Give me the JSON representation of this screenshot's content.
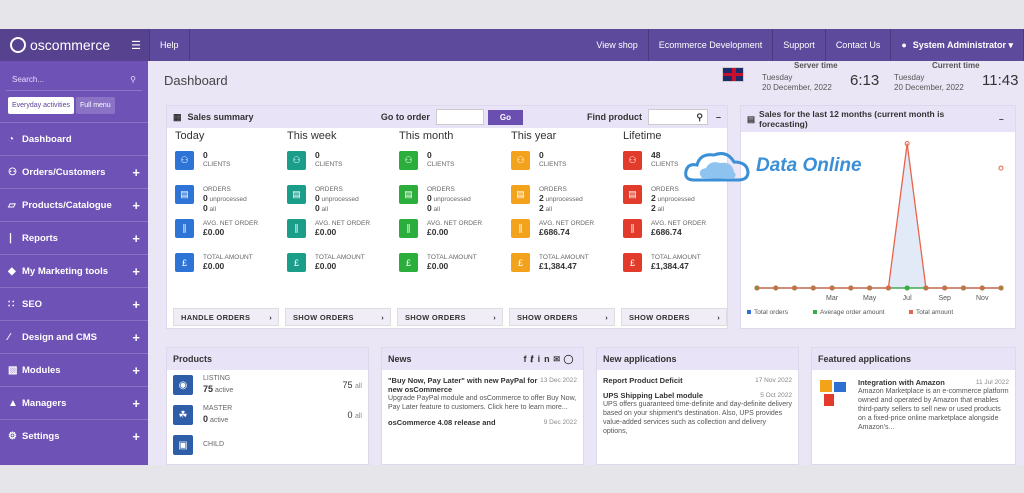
{
  "topbar": {
    "logo": "oscommerce",
    "help": "Help",
    "view_shop": "View shop",
    "ecom_dev": "Ecommerce Development",
    "support": "Support",
    "contact": "Contact Us",
    "user": "System Administrator ▾"
  },
  "sidebar": {
    "search_placeholder": "Search...",
    "tab_everyday": "Everyday activities",
    "tab_full": "Full menu",
    "items": [
      {
        "label": "Dashboard",
        "icon": "tachometer-icon"
      },
      {
        "label": "Orders/Customers",
        "icon": "users-icon"
      },
      {
        "label": "Products/Catalogue",
        "icon": "folder-icon"
      },
      {
        "label": "Reports",
        "icon": "chart-icon"
      },
      {
        "label": "My Marketing tools",
        "icon": "tag-icon"
      },
      {
        "label": "SEO",
        "icon": "sitemap-icon"
      },
      {
        "label": "Design and CMS",
        "icon": "brush-icon"
      },
      {
        "label": "Modules",
        "icon": "puzzle-icon"
      },
      {
        "label": "Managers",
        "icon": "user-icon"
      },
      {
        "label": "Settings",
        "icon": "cogs-icon"
      }
    ]
  },
  "header": {
    "title": "Dashboard",
    "server_label": "Server time",
    "server_day": "Tuesday",
    "server_date": "20 December, 2022",
    "server_time": "6:13",
    "current_label": "Current time",
    "current_day": "Tuesday",
    "current_date": "20 December, 2022",
    "current_time": "11:43"
  },
  "sales": {
    "title": "Sales summary",
    "go_to_order": "Go to order",
    "go": "Go",
    "find_product": "Find product",
    "columns": [
      {
        "title": "Today",
        "color": "#2e73d6",
        "clients": "0",
        "orders": "0",
        "unprocessed": "0",
        "all": "0",
        "avg": "£0.00",
        "total": "£0.00",
        "btn": "HANDLE ORDERS"
      },
      {
        "title": "This week",
        "color": "#1a9e8a",
        "clients": "0",
        "orders": "0",
        "unprocessed": "0",
        "all": "0",
        "avg": "£0.00",
        "total": "£0.00",
        "btn": "SHOW ORDERS"
      },
      {
        "title": "This month",
        "color": "#2cae3c",
        "clients": "0",
        "orders": "0",
        "unprocessed": "0",
        "all": "0",
        "avg": "£0.00",
        "total": "£0.00",
        "btn": "SHOW ORDERS"
      },
      {
        "title": "This year",
        "color": "#f3a21c",
        "clients": "0",
        "orders": "0",
        "unprocessed": "2",
        "all": "2",
        "avg": "£686.74",
        "total": "£1,384.47",
        "btn": "SHOW ORDERS"
      },
      {
        "title": "Lifetime",
        "color": "#e23b2c",
        "clients": "48",
        "orders": "0",
        "unprocessed": "2",
        "all": "2",
        "avg": "£686.74",
        "total": "£1,384.47",
        "btn": "SHOW ORDERS"
      }
    ],
    "lbl_clients": "CLIENTS",
    "lbl_orders": "ORDERS",
    "lbl_unprocessed": "unprocessed",
    "lbl_all": "all",
    "lbl_avg": "AVG. NET ORDER",
    "lbl_total": "TOTAL AMOUNT"
  },
  "chart_title": "Sales for the last 12 months (current month is forecasting)",
  "chart_data": {
    "type": "line",
    "x": [
      "",
      "",
      "",
      "",
      "Mar",
      "",
      "May",
      "",
      "Jul",
      "",
      "Sep",
      "",
      "Nov",
      ""
    ],
    "ticks": [
      "Mar",
      "May",
      "Jul",
      "Sep",
      "Nov"
    ],
    "series": [
      {
        "name": "Total orders",
        "color": "#2e6fd1",
        "values": [
          0,
          0,
          0,
          0,
          0,
          0,
          0,
          0,
          0,
          0,
          0,
          0,
          0,
          0
        ]
      },
      {
        "name": "Average order amount",
        "color": "#3cae3c",
        "values": [
          0,
          0,
          0,
          0,
          0,
          0,
          0,
          0,
          0,
          0,
          0,
          0,
          0,
          0
        ]
      },
      {
        "name": "Total amount",
        "color": "#e8654a",
        "values": [
          0,
          0,
          0,
          0,
          0,
          0,
          0,
          0,
          1384.47,
          0,
          0,
          0,
          0,
          0
        ]
      }
    ],
    "forecast_point": {
      "index": 13,
      "value": 1150
    },
    "ylim": [
      0,
      1400
    ]
  },
  "products": {
    "title": "Products",
    "items": [
      {
        "label": "LISTING",
        "count": "75",
        "state": "active",
        "total": "75",
        "total_lbl": "all"
      },
      {
        "label": "MASTER",
        "count": "0",
        "state": "active",
        "total": "0",
        "total_lbl": "all"
      },
      {
        "label": "CHILD",
        "count": "",
        "state": "",
        "total": "",
        "total_lbl": ""
      }
    ]
  },
  "news": {
    "title": "News",
    "items": [
      {
        "title": "\"Buy Now, Pay Later\" with new PayPal for new osCommerce",
        "date": "13 Dec 2022",
        "body": "Upgrade PayPal module and osCommerce to offer Buy Now, Pay Later feature to customers. Click here to learn more..."
      },
      {
        "title": "osCommerce 4.08 release and",
        "date": "9 Dec 2022",
        "body": ""
      }
    ]
  },
  "new_apps": {
    "title": "New applications",
    "items": [
      {
        "title": "Report Product Deficit",
        "date": "17 Nov 2022",
        "body": ""
      },
      {
        "title": "UPS Shipping Label module",
        "date": "5 Oct 2022",
        "body": "UPS offers guaranteed time-definite and day-definite delivery based on your shipment's destination. Also, UPS provides value-added services such as collection and delivery options,"
      }
    ]
  },
  "featured": {
    "title": "Featured applications",
    "name": "Integration with Amazon",
    "date": "11 Jul 2022",
    "body": "Amazon Marketplace is an e-commerce platform owned and operated by Amazon that enables third-party sellers to sell new or used products on a fixed-price online marketplace alongside Amazon's..."
  },
  "watermark": "Data Online"
}
